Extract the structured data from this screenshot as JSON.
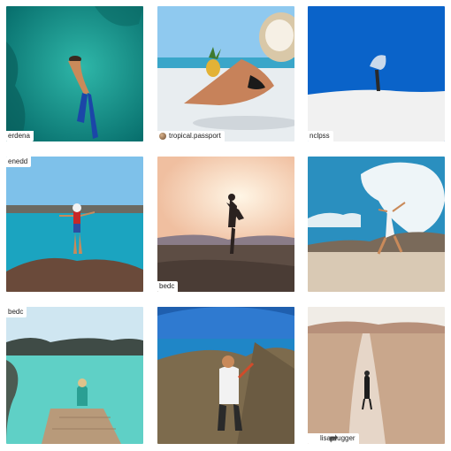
{
  "tiles": [
    {
      "scene": "snorkeler-reef",
      "colors": {
        "main": "#0e8f8a",
        "light": "#2fb7a9"
      },
      "caption": "erdena"
    },
    {
      "scene": "beach-pineapple-sun-hat",
      "colors": {
        "sky": "#8fc9ef",
        "sea": "#3aa6c9",
        "sand": "#e8edf0"
      },
      "caption": "tropical.passport",
      "avatar": true
    },
    {
      "scene": "white-dune-blue-sky",
      "colors": {
        "sky": "#0a63c9",
        "dune": "#f1f1f1"
      },
      "caption": "nclpss"
    },
    {
      "scene": "woman-on-rock-lagoon",
      "colors": {
        "sky": "#7ec1ea",
        "sea": "#1ba4c0",
        "rock": "#6a4a3a"
      },
      "caption": "enedd"
    },
    {
      "scene": "sunset-couple-beach",
      "colors": {
        "sky": "#f7d7bf",
        "sand": "#5d4d44"
      },
      "caption": "bedc"
    },
    {
      "scene": "desert-jump-clouds",
      "colors": {
        "sky": "#2a8fbf",
        "cloud": "#eef5f8",
        "ground": "#d9c9b4"
      },
      "caption": ""
    },
    {
      "scene": "natural-pool-pier",
      "colors": {
        "sky": "#cfe6f1",
        "sea": "#5fd0c6",
        "pier": "#b89a7a"
      },
      "caption": "bedc"
    },
    {
      "scene": "mountain-selfie-coast",
      "colors": {
        "sky": "#2f7ad0",
        "sea": "#1f86c7",
        "rock": "#7d6b4d"
      },
      "caption": ""
    },
    {
      "scene": "desert-track-walker",
      "colors": {
        "sky": "#f0ece6",
        "ground": "#c9a78c"
      },
      "caption": "lisaprugger",
      "repost": true
    }
  ]
}
